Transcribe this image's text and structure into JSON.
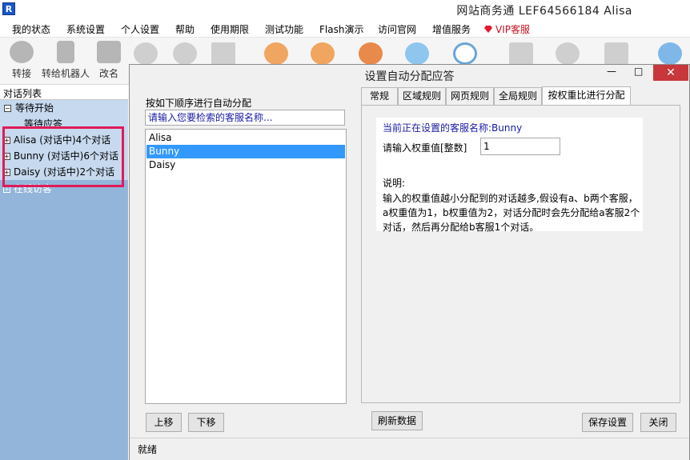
{
  "app": {
    "title": "网站商务通  LEF64566184 Alisa",
    "logo_text": "R"
  },
  "menu": [
    {
      "label": "我的状态"
    },
    {
      "label": "系统设置"
    },
    {
      "label": "个人设置"
    },
    {
      "label": "帮助"
    },
    {
      "label": "使用期限"
    },
    {
      "label": "测试功能"
    },
    {
      "label": "Flash演示"
    },
    {
      "label": "访问官网"
    },
    {
      "label": "增值服务"
    },
    {
      "label": "VIP客服"
    }
  ],
  "toolbar": {
    "transfer_label": "转接",
    "transfer_robot_label": "转给机器人",
    "rename_label": "改名"
  },
  "left_panel": {
    "header": "对话列表",
    "waiting_group": "等待开始",
    "waiting_sub": "等待应答",
    "agents": [
      {
        "label": "Alisa (对话中)4个对话"
      },
      {
        "label": "Bunny (对话中)6个对话"
      },
      {
        "label": "Daisy (对话中)2个对话"
      }
    ],
    "online_partial": "在线访客"
  },
  "dialog": {
    "title": "设置自动分配应答",
    "min_symbol": "—",
    "max_symbol": "□",
    "close_symbol": "✕",
    "order_label": "按如下顺序进行自动分配",
    "search_placeholder": "请输入您要检索的客服名称...",
    "agents": [
      "Alisa",
      "Bunny",
      "Daisy"
    ],
    "selected_agent": "Bunny",
    "move_up": "上移",
    "move_down": "下移",
    "refresh": "刷新数据",
    "save": "保存设置",
    "close": "关闭",
    "status": "就绪",
    "tabs": [
      {
        "label": "常规"
      },
      {
        "label": "区域规则"
      },
      {
        "label": "网页规则"
      },
      {
        "label": "全局规则"
      },
      {
        "label": "按权重比进行分配"
      }
    ],
    "active_tab": "按权重比进行分配",
    "current_agent_text": "当前正在设置的客服名称:Bunny",
    "weight_label": "请输入权重值[整数]",
    "weight_value": "1",
    "note_title": "说明:",
    "note_lines": [
      "输入的权重值越小分配到的对话越多,假设有a、b两个客服，",
      "a权重值为1，b权重值为2，对话分配时会先分配给a客服2个",
      "对话，然后再分配给b客服1个对话。"
    ]
  },
  "colors": {
    "left_panel_bg": "#93b5d9",
    "highlight_border": "#e01b5a",
    "selection": "#3399ff",
    "info_text": "#1a1aa6",
    "close_button": "#c7373c"
  }
}
